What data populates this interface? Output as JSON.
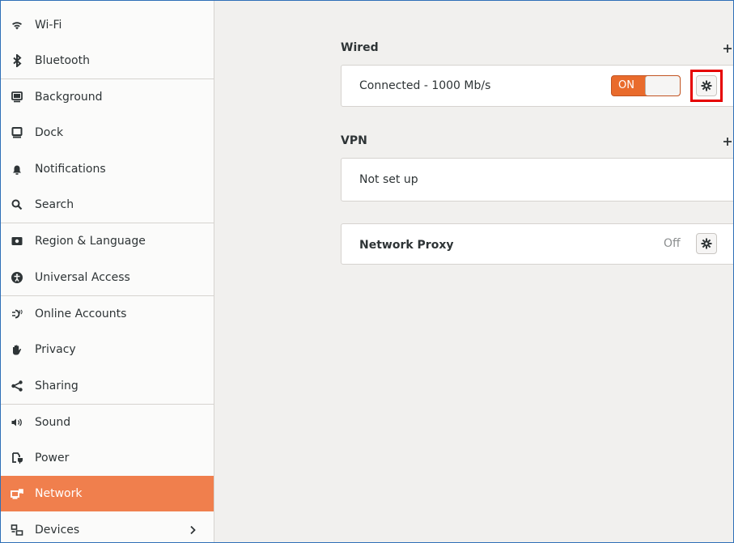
{
  "sidebar": {
    "items": [
      {
        "label": "Wi-Fi",
        "icon": "wifi-icon"
      },
      {
        "label": "Bluetooth",
        "icon": "bluetooth-icon"
      },
      {
        "label": "Background",
        "icon": "background-icon"
      },
      {
        "label": "Dock",
        "icon": "dock-icon"
      },
      {
        "label": "Notifications",
        "icon": "bell-icon"
      },
      {
        "label": "Search",
        "icon": "search-icon"
      },
      {
        "label": "Region & Language",
        "icon": "region-icon"
      },
      {
        "label": "Universal Access",
        "icon": "universal-access-icon"
      },
      {
        "label": "Online Accounts",
        "icon": "online-accounts-icon"
      },
      {
        "label": "Privacy",
        "icon": "hand-icon"
      },
      {
        "label": "Sharing",
        "icon": "share-icon"
      },
      {
        "label": "Sound",
        "icon": "speaker-icon"
      },
      {
        "label": "Power",
        "icon": "power-plug-icon"
      },
      {
        "label": "Network",
        "icon": "network-icon",
        "active": true
      },
      {
        "label": "Devices",
        "icon": "devices-icon",
        "has_submenu": true
      }
    ]
  },
  "main": {
    "wired": {
      "title": "Wired",
      "connection_label": "Connected - 1000 Mb/s",
      "toggle_label": "ON",
      "toggle_state": "on"
    },
    "vpn": {
      "title": "VPN",
      "status": "Not set up"
    },
    "proxy": {
      "title": "Network Proxy",
      "status": "Off"
    }
  },
  "colors": {
    "accent": "#f07f4d",
    "toggle_on": "#e96b2c",
    "highlight": "#e60000",
    "background": "#f1f0ee"
  }
}
